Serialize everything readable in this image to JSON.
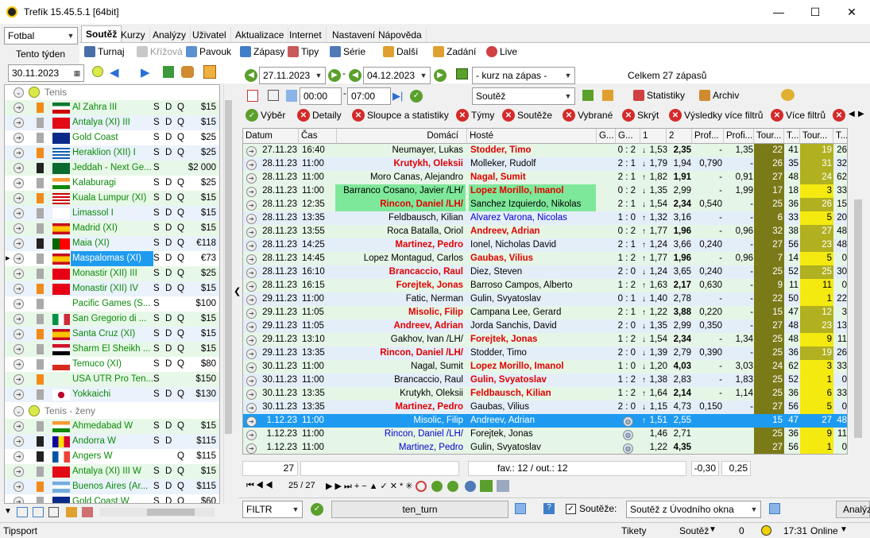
{
  "window": {
    "title": "Trefík 15.45.5.1 [64bit]",
    "min": "—",
    "max": "☐",
    "close": "✕"
  },
  "sport_select": "Fotbal",
  "tabs": [
    "Soutěž",
    "Kurzy",
    "Analýzy",
    "Uživatel",
    "Aktualizace",
    "Internet",
    "Nastavení",
    "Nápověda"
  ],
  "week_label": "Tento týden",
  "toolbar1": {
    "turnaj": "Turnaj",
    "krizova": "Křížová",
    "pavouk": "Pavouk",
    "zapasy": "Zápasy",
    "tipy": "Tipy",
    "serie": "Série",
    "dalsi": "Další",
    "zadani": "Zadání",
    "live": "Live"
  },
  "date_left": "30.11.2023",
  "date_from": "27.11.2023",
  "date_to": "04.12.2023",
  "kurz_select": "- kurz na zápas -",
  "total": "Celkem 27 zápasů",
  "time_from": "00:00",
  "time_to": "07:00",
  "sout_select": "Soutěž",
  "statistiky": "Statistiky",
  "archiv": "Archiv",
  "filters": {
    "vyber": "Výběr",
    "detaily": "Detaily",
    "sloupce": "Sloupce a statistiky",
    "tymy": "Týmy",
    "souteze": "Soutěže",
    "vybrane": "Vybrané",
    "skryt": "Skrýt",
    "vysledky": "Výsledky více filtrů",
    "vice": "Více filtrů"
  },
  "groups": [
    {
      "title": "Tenis",
      "start": 0
    },
    {
      "title": "Tenis - ženy",
      "start": 20
    }
  ],
  "tournaments": [
    {
      "name": "Al Zahra III",
      "sdq": [
        "S",
        "D",
        "Q"
      ],
      "price": "$15",
      "flag": "kw",
      "bg": "#e8f8e8"
    },
    {
      "name": "Antalya (XI) III",
      "sdq": [
        "S",
        "D",
        "Q"
      ],
      "price": "$15",
      "flag": "tr",
      "bg": "#eaf2fc"
    },
    {
      "name": "Gold Coast",
      "sdq": [
        "S",
        "D",
        "Q"
      ],
      "price": "$25",
      "flag": "au",
      "bg": "#fff"
    },
    {
      "name": "Heraklion (XII) I",
      "sdq": [
        "S",
        "D",
        "Q"
      ],
      "price": "$25",
      "flag": "gr",
      "bg": "#eaf2fc"
    },
    {
      "name": "Jeddah - Next Ge...",
      "sdq": [
        "S",
        "",
        ""
      ],
      "price": "$2 000",
      "flag": "sa",
      "bg": "#e8f8e8"
    },
    {
      "name": "Kalaburagi",
      "sdq": [
        "S",
        "D",
        "Q"
      ],
      "price": "$25",
      "flag": "in",
      "bg": "#fff"
    },
    {
      "name": "Kuala Lumpur (XI)",
      "sdq": [
        "S",
        "D",
        "Q"
      ],
      "price": "$15",
      "flag": "my",
      "bg": "#e8f8e8"
    },
    {
      "name": "Limassol I",
      "sdq": [
        "S",
        "D",
        "Q"
      ],
      "price": "$15",
      "flag": "cy",
      "bg": "#eaf2fc"
    },
    {
      "name": "Madrid (XI)",
      "sdq": [
        "S",
        "D",
        "Q"
      ],
      "price": "$15",
      "flag": "es",
      "bg": "#e8f8e8"
    },
    {
      "name": "Maia (XI)",
      "sdq": [
        "S",
        "D",
        "Q"
      ],
      "price": "€118",
      "flag": "pt",
      "bg": "#eaf2fc"
    },
    {
      "name": "Maspalomas (XI)",
      "sdq": [
        "S",
        "D",
        "Q"
      ],
      "price": "€73",
      "flag": "es",
      "bg": "#fff",
      "selected": true
    },
    {
      "name": "Monastir (XII) III",
      "sdq": [
        "S",
        "D",
        "Q"
      ],
      "price": "$25",
      "flag": "tn",
      "bg": "#e8f8e8"
    },
    {
      "name": "Monastir (XII) IV",
      "sdq": [
        "S",
        "D",
        "Q"
      ],
      "price": "$15",
      "flag": "tn",
      "bg": "#eaf2fc"
    },
    {
      "name": "Pacific Games (S...",
      "sdq": [
        "S",
        "",
        ""
      ],
      "price": "$100",
      "flag": "",
      "bg": "#fff"
    },
    {
      "name": "San Gregorio di ...",
      "sdq": [
        "S",
        "D",
        "Q"
      ],
      "price": "$15",
      "flag": "it",
      "bg": "#e8f8e8"
    },
    {
      "name": "Santa Cruz (XI)",
      "sdq": [
        "S",
        "D",
        "Q"
      ],
      "price": "$15",
      "flag": "es",
      "bg": "#eaf2fc"
    },
    {
      "name": "Sharm El Sheikh ...",
      "sdq": [
        "S",
        "D",
        "Q"
      ],
      "price": "$15",
      "flag": "eg",
      "bg": "#e8f8e8"
    },
    {
      "name": "Temuco (XI)",
      "sdq": [
        "S",
        "D",
        "Q"
      ],
      "price": "$80",
      "flag": "cl",
      "bg": "#fff"
    },
    {
      "name": "USA UTR Pro Ten...",
      "sdq": [
        "S",
        "",
        ""
      ],
      "price": "$150",
      "flag": "",
      "bg": "#e8f8e8"
    },
    {
      "name": "Yokkaichi",
      "sdq": [
        "S",
        "D",
        "Q"
      ],
      "price": "$130",
      "flag": "jp",
      "bg": "#eaf2fc"
    },
    {
      "name": "Ahmedabad W",
      "sdq": [
        "S",
        "D",
        "Q"
      ],
      "price": "$15",
      "flag": "in",
      "bg": "#e8f8e8"
    },
    {
      "name": "Andorra W",
      "sdq": [
        "S",
        "D",
        ""
      ],
      "price": "$115",
      "flag": "ad",
      "bg": "#eaf2fc"
    },
    {
      "name": "Angers W",
      "sdq": [
        "",
        "",
        "Q"
      ],
      "price": "$115",
      "flag": "fr",
      "bg": "#fff"
    },
    {
      "name": "Antalya (XI) III W",
      "sdq": [
        "S",
        "D",
        "Q"
      ],
      "price": "$15",
      "flag": "tr",
      "bg": "#e8f8e8"
    },
    {
      "name": "Buenos Aires (Ar...",
      "sdq": [
        "S",
        "D",
        "Q"
      ],
      "price": "$115",
      "flag": "ar",
      "bg": "#eaf2fc"
    },
    {
      "name": "Gold Coast W",
      "sdq": [
        "S",
        "D",
        "Q"
      ],
      "price": "$60",
      "flag": "au",
      "bg": "#fff"
    }
  ],
  "columns": [
    "Datum",
    "Čas",
    "Domácí",
    "Hosté",
    "G...",
    "G...",
    "1",
    "2",
    "Prof...",
    "Profi...",
    "Tour...",
    "T...",
    "Tour...",
    "T..."
  ],
  "matches": [
    [
      "27.11.23",
      "16:40",
      "Neumayer, Lukas",
      "Stodder, Timo",
      "0 : 2",
      "↓",
      "1,53",
      "2,35",
      "-",
      "1,35",
      "22",
      "41",
      "19",
      "26",
      "n",
      "r",
      "g"
    ],
    [
      "28.11.23",
      "11:00",
      "Krutykh, Oleksii",
      "Molleker, Rudolf",
      "2 : 1",
      "↓",
      "1,79",
      "1,94",
      "0,790",
      "-",
      "26",
      "35",
      "31",
      "32",
      "r",
      "n",
      "b"
    ],
    [
      "28.11.23",
      "11:00",
      "Moro Canas, Alejandro",
      "Nagal, Sumit",
      "2 : 1",
      "↑",
      "1,82",
      "1,91",
      "-",
      "0,91",
      "27",
      "48",
      "24",
      "62",
      "n",
      "r",
      "g"
    ],
    [
      "28.11.23",
      "11:00",
      "Barranco Cosano, Javier /LH/",
      "Lopez Morillo, Imanol",
      "0 : 2",
      "↓",
      "1,35",
      "2,99",
      "-",
      "1,99",
      "17",
      "18",
      "3",
      "33",
      "n",
      "r",
      "hl"
    ],
    [
      "28.11.23",
      "12:35",
      "Rincon, Daniel /LH/",
      "Sanchez Izquierdo, Nikolas",
      "2 : 1",
      "↓",
      "1,54",
      "2,34",
      "0,540",
      "-",
      "25",
      "36",
      "26",
      "15",
      "r",
      "n",
      "hl"
    ],
    [
      "28.11.23",
      "13:35",
      "Feldbausch, Kilian",
      "Alvarez Varona, Nicolas",
      "1 : 0",
      "↑",
      "1,32",
      "3,16",
      "-",
      "-",
      "6",
      "33",
      "5",
      "20",
      "n",
      "bl",
      "b"
    ],
    [
      "28.11.23",
      "13:55",
      "Roca Batalla, Oriol",
      "Andreev, Adrian",
      "0 : 2",
      "↑",
      "1,77",
      "1,96",
      "-",
      "0,96",
      "32",
      "38",
      "27",
      "48",
      "n",
      "r",
      "g"
    ],
    [
      "28.11.23",
      "14:25",
      "Martinez, Pedro",
      "Ionel, Nicholas David",
      "2 : 1",
      "↑",
      "1,24",
      "3,66",
      "0,240",
      "-",
      "27",
      "56",
      "23",
      "48",
      "r",
      "n",
      "b"
    ],
    [
      "28.11.23",
      "14:45",
      "Lopez Montagud, Carlos",
      "Gaubas, Vilius",
      "1 : 2",
      "↑",
      "1,77",
      "1,96",
      "-",
      "0,96",
      "7",
      "14",
      "5",
      "0",
      "n",
      "r",
      "g"
    ],
    [
      "28.11.23",
      "16:10",
      "Brancaccio, Raul",
      "Diez, Steven",
      "2 : 0",
      "↓",
      "1,24",
      "3,65",
      "0,240",
      "-",
      "25",
      "52",
      "25",
      "30",
      "r",
      "n",
      "b"
    ],
    [
      "28.11.23",
      "16:15",
      "Forejtek, Jonas",
      "Barroso Campos, Alberto",
      "1 : 2",
      "↑",
      "1,63",
      "2,17",
      "0,630",
      "-",
      "9",
      "11",
      "11",
      "0",
      "r",
      "n",
      "g"
    ],
    [
      "29.11.23",
      "11:00",
      "Fatic, Nerman",
      "Gulin, Svyatoslav",
      "0 : 1",
      "↓",
      "1,40",
      "2,78",
      "-",
      "-",
      "22",
      "50",
      "1",
      "22",
      "n",
      "n",
      "b"
    ],
    [
      "29.11.23",
      "11:05",
      "Misolic, Filip",
      "Campana Lee, Gerard",
      "2 : 1",
      "↑",
      "1,22",
      "3,88",
      "0,220",
      "-",
      "15",
      "47",
      "12",
      "3",
      "r",
      "n",
      "g"
    ],
    [
      "29.11.23",
      "11:05",
      "Andreev, Adrian",
      "Jorda Sanchis, David",
      "2 : 0",
      "↓",
      "1,35",
      "2,99",
      "0,350",
      "-",
      "27",
      "48",
      "23",
      "13",
      "r",
      "n",
      "b"
    ],
    [
      "29.11.23",
      "13:10",
      "Gakhov, Ivan /LH/",
      "Forejtek, Jonas",
      "1 : 2",
      "↓",
      "1,54",
      "2,34",
      "-",
      "1,34",
      "25",
      "48",
      "9",
      "11",
      "n",
      "r",
      "g"
    ],
    [
      "29.11.23",
      "13:35",
      "Rincon, Daniel /LH/",
      "Stodder, Timo",
      "2 : 0",
      "↓",
      "1,39",
      "2,79",
      "0,390",
      "-",
      "25",
      "36",
      "19",
      "26",
      "r",
      "n",
      "b"
    ],
    [
      "30.11.23",
      "11:00",
      "Nagal, Sumit",
      "Lopez Morillo, Imanol",
      "1 : 0",
      "↓",
      "1,20",
      "4,03",
      "-",
      "3,03",
      "24",
      "62",
      "3",
      "33",
      "n",
      "r",
      "g"
    ],
    [
      "30.11.23",
      "11:00",
      "Brancaccio, Raul",
      "Gulin, Svyatoslav",
      "1 : 2",
      "↑",
      "1,38",
      "2,83",
      "-",
      "1,83",
      "25",
      "52",
      "1",
      "0",
      "n",
      "r",
      "b"
    ],
    [
      "30.11.23",
      "13:35",
      "Krutykh, Oleksii",
      "Feldbausch, Kilian",
      "1 : 2",
      "↑",
      "1,64",
      "2,14",
      "-",
      "1,14",
      "25",
      "36",
      "6",
      "33",
      "n",
      "r",
      "g"
    ],
    [
      "30.11.23",
      "13:35",
      "Martinez, Pedro",
      "Gaubas, Vilius",
      "2 : 0",
      "↓",
      "1,15",
      "4,73",
      "0,150",
      "-",
      "27",
      "56",
      "5",
      "0",
      "r",
      "n",
      "b"
    ],
    [
      "1.12.23",
      "11:00",
      "Misolic, Filip",
      "Andreev, Adrian",
      "",
      "↑",
      "1,51",
      "2,55",
      "",
      "",
      "15",
      "47",
      "27",
      "48",
      "n",
      "n",
      "sel"
    ],
    [
      "1.12.23",
      "11:00",
      "Rincon, Daniel /LH/",
      "Forejtek, Jonas",
      "",
      "",
      "1,46",
      "2,71",
      "",
      "",
      "25",
      "36",
      "9",
      "11",
      "bl",
      "n",
      "g"
    ],
    [
      "1.12.23",
      "11:00",
      "Martinez, Pedro",
      "Gulin, Svyatoslav",
      "",
      "",
      "1,22",
      "4,35",
      "",
      "",
      "27",
      "56",
      "1",
      "0",
      "bl",
      "n",
      "g"
    ]
  ],
  "footer": {
    "count": "27",
    "favout": "fav.: 12 / out.: 12",
    "v1": "-0,30",
    "v2": "0,25",
    "nav": "25 / 27"
  },
  "bottom": {
    "filtr": "FILTR",
    "turn": "ten_turn",
    "souteze_label": "Soutěže:",
    "souteze_select": "Soutěž z Úvodního okna",
    "analyzy": "Analýz"
  },
  "status": {
    "tipsport": "Tipsport",
    "tikety": "Tikety",
    "soutez": "Soutěž",
    "zero": "0",
    "time": "17:31",
    "online": "Online"
  }
}
